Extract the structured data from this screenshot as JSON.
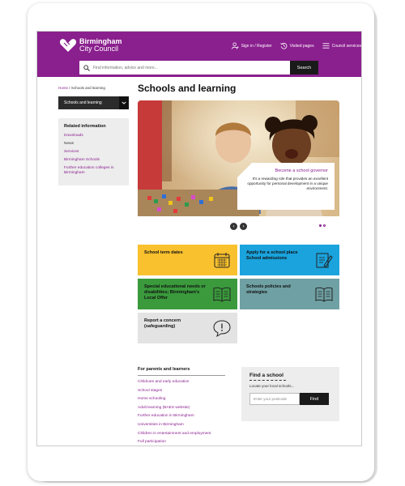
{
  "header": {
    "logo_line1": "Birmingham",
    "logo_line2": "City Council",
    "nav": [
      {
        "label": "Sign in / Register",
        "icon": "user-icon"
      },
      {
        "label": "Visited pages",
        "icon": "history-icon"
      },
      {
        "label": "Council services",
        "icon": "menu-icon"
      }
    ],
    "search_placeholder": "Find information, advice and more...",
    "search_button": "Search"
  },
  "breadcrumb": {
    "home": "Home",
    "separator": "/",
    "current": "Schools and learning"
  },
  "section_select": {
    "value": "Schools and learning"
  },
  "related": {
    "title": "Related information",
    "links": [
      "Downloads",
      "News",
      "Services",
      "Birmingham Schools",
      "Further education colleges in Birmingham"
    ]
  },
  "page_title": "Schools and learning",
  "hero": {
    "card_title": "Become a school governor",
    "card_text": "It's a rewarding role that provides an excellent opportunity for personal development in a unique environment.",
    "prev": "‹",
    "next": "›"
  },
  "tiles": [
    {
      "label": "School term dates",
      "color": "#f9c12e",
      "icon": "calendar-icon"
    },
    {
      "label": "Apply for a school place School admissions",
      "color": "#1aa3dd",
      "icon": "form-edit-icon"
    },
    {
      "label": "Special educational needs or disabilities; Birmingham's Local Offer",
      "color": "#3a9a3c",
      "icon": "book-icon"
    },
    {
      "label": "Schools policies and strategies",
      "color": "#6fa0a3",
      "icon": "book-icon"
    },
    {
      "label": "Report a concern (safeguarding)",
      "color": "#e3e3e3",
      "icon": "alert-bubble-icon"
    }
  ],
  "parents": {
    "title": "For parents and learners",
    "links": [
      "Childcare and early education",
      "School stages",
      "Home schooling",
      "Adult learning (BAES website)",
      "Further education in Birmingham",
      "Universities in Birmingham",
      "Children in entertainment and employment",
      "Full participation"
    ]
  },
  "find_school": {
    "title": "Find a school",
    "subtitle": "Locate your local schools...",
    "placeholder": "Enter your postcode",
    "button": "Find"
  },
  "colors": {
    "brand": "#8a1f8e",
    "dark": "#1a1a1a"
  }
}
